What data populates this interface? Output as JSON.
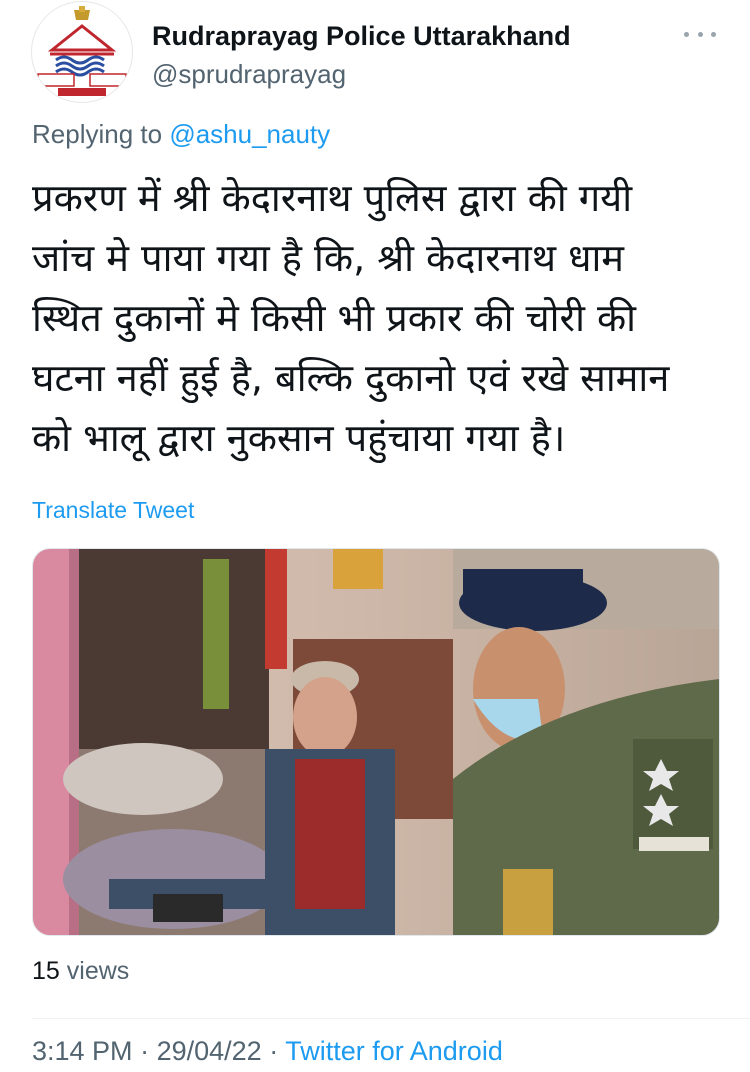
{
  "profile": {
    "display_name": "Rudraprayag Police Uttarakhand",
    "handle": "@sprudraprayag",
    "more_icon": "more-horizontal-icon"
  },
  "reply": {
    "prefix": "Replying to",
    "mention": "@ashu_nauty"
  },
  "tweet": {
    "lines": [
      "प्रकरण में श्री केदारनाथ पुलिस द्वारा की गयी",
      "जांच मे पाया गया है कि, श्री केदारनाथ धाम",
      "स्थित दुकानों मे किसी भी प्रकार की चोरी की",
      "घटना नहीं हुई है, बल्कि दुकानो एवं रखे सामान",
      "को भालू द्वारा नुकसान पहुंचाया गया है।"
    ],
    "translate_label": "Translate Tweet"
  },
  "stats": {
    "views_count": "15",
    "views_label": "views"
  },
  "meta": {
    "time": "3:14 PM",
    "separator": "·",
    "date": "29/04/22",
    "source": "Twitter for Android"
  },
  "colors": {
    "link": "#1d9bf0",
    "secondary_text": "#536471",
    "primary_text": "#0f1419"
  }
}
